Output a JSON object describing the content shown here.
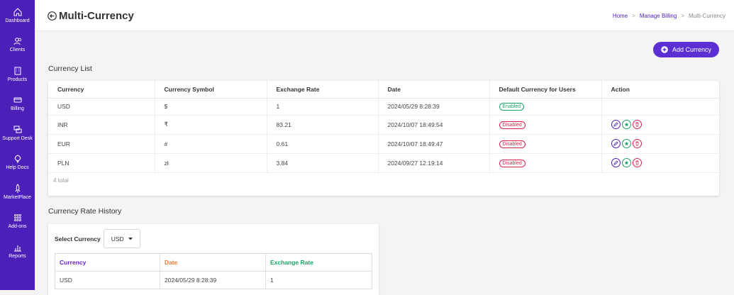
{
  "sidebar": {
    "items": [
      {
        "label": "Dashboard",
        "icon": "home-icon"
      },
      {
        "label": "Clients",
        "icon": "users-icon"
      },
      {
        "label": "Products",
        "icon": "building-icon"
      },
      {
        "label": "Billing",
        "icon": "card-icon"
      },
      {
        "label": "Support Desk",
        "icon": "chat-icon"
      },
      {
        "label": "Help Docs",
        "icon": "bulb-icon"
      },
      {
        "label": "MarketPlace",
        "icon": "rocket-icon"
      },
      {
        "label": "Add-ons",
        "icon": "grid-icon"
      },
      {
        "label": "Reports",
        "icon": "chart-icon"
      }
    ]
  },
  "header": {
    "title": "Multi-Currency",
    "breadcrumb": {
      "home": "Home",
      "billing": "Manage Billing",
      "current": "Multi-Currency",
      "sep": ">"
    }
  },
  "add_button": {
    "label": "Add Currency"
  },
  "currency_list": {
    "title": "Currency List",
    "columns": [
      "Currency",
      "Currency Symbol",
      "Exchange Rate",
      "Date",
      "Default Currency for Users",
      "Action"
    ],
    "rows": [
      {
        "currency": "USD",
        "symbol": "$",
        "rate": "1",
        "date": "2024/05/29 8:28:39",
        "status": "Enabled",
        "has_actions": false
      },
      {
        "currency": "INR",
        "symbol": "₹",
        "rate": "83.21",
        "date": "2024/10/07 18:49:54",
        "status": "Disabled",
        "has_actions": true
      },
      {
        "currency": "EUR",
        "symbol": "#",
        "rate": "0.61",
        "date": "2024/10/07 18:49:47",
        "status": "Disabled",
        "has_actions": true
      },
      {
        "currency": "PLN",
        "symbol": "zł",
        "rate": "3.84",
        "date": "2024/09/27 12:19:14",
        "status": "Disabled",
        "has_actions": true
      }
    ],
    "total": "4 total"
  },
  "rate_history": {
    "title": "Currency Rate History",
    "select_label": "Select Currency",
    "selected": "USD",
    "columns": [
      "Currency",
      "Date",
      "Exchange Rate"
    ],
    "column_colors": [
      "#6a1fd1",
      "#f07a2e",
      "#1aa564"
    ],
    "rows": [
      {
        "currency": "USD",
        "date": "2024/05/29 8:28:39",
        "rate": "1"
      }
    ]
  },
  "colors": {
    "sidebar": "#4b1fb8",
    "accent": "#5b2fd1",
    "enabled": "#1aa564",
    "disabled": "#d6234b"
  }
}
